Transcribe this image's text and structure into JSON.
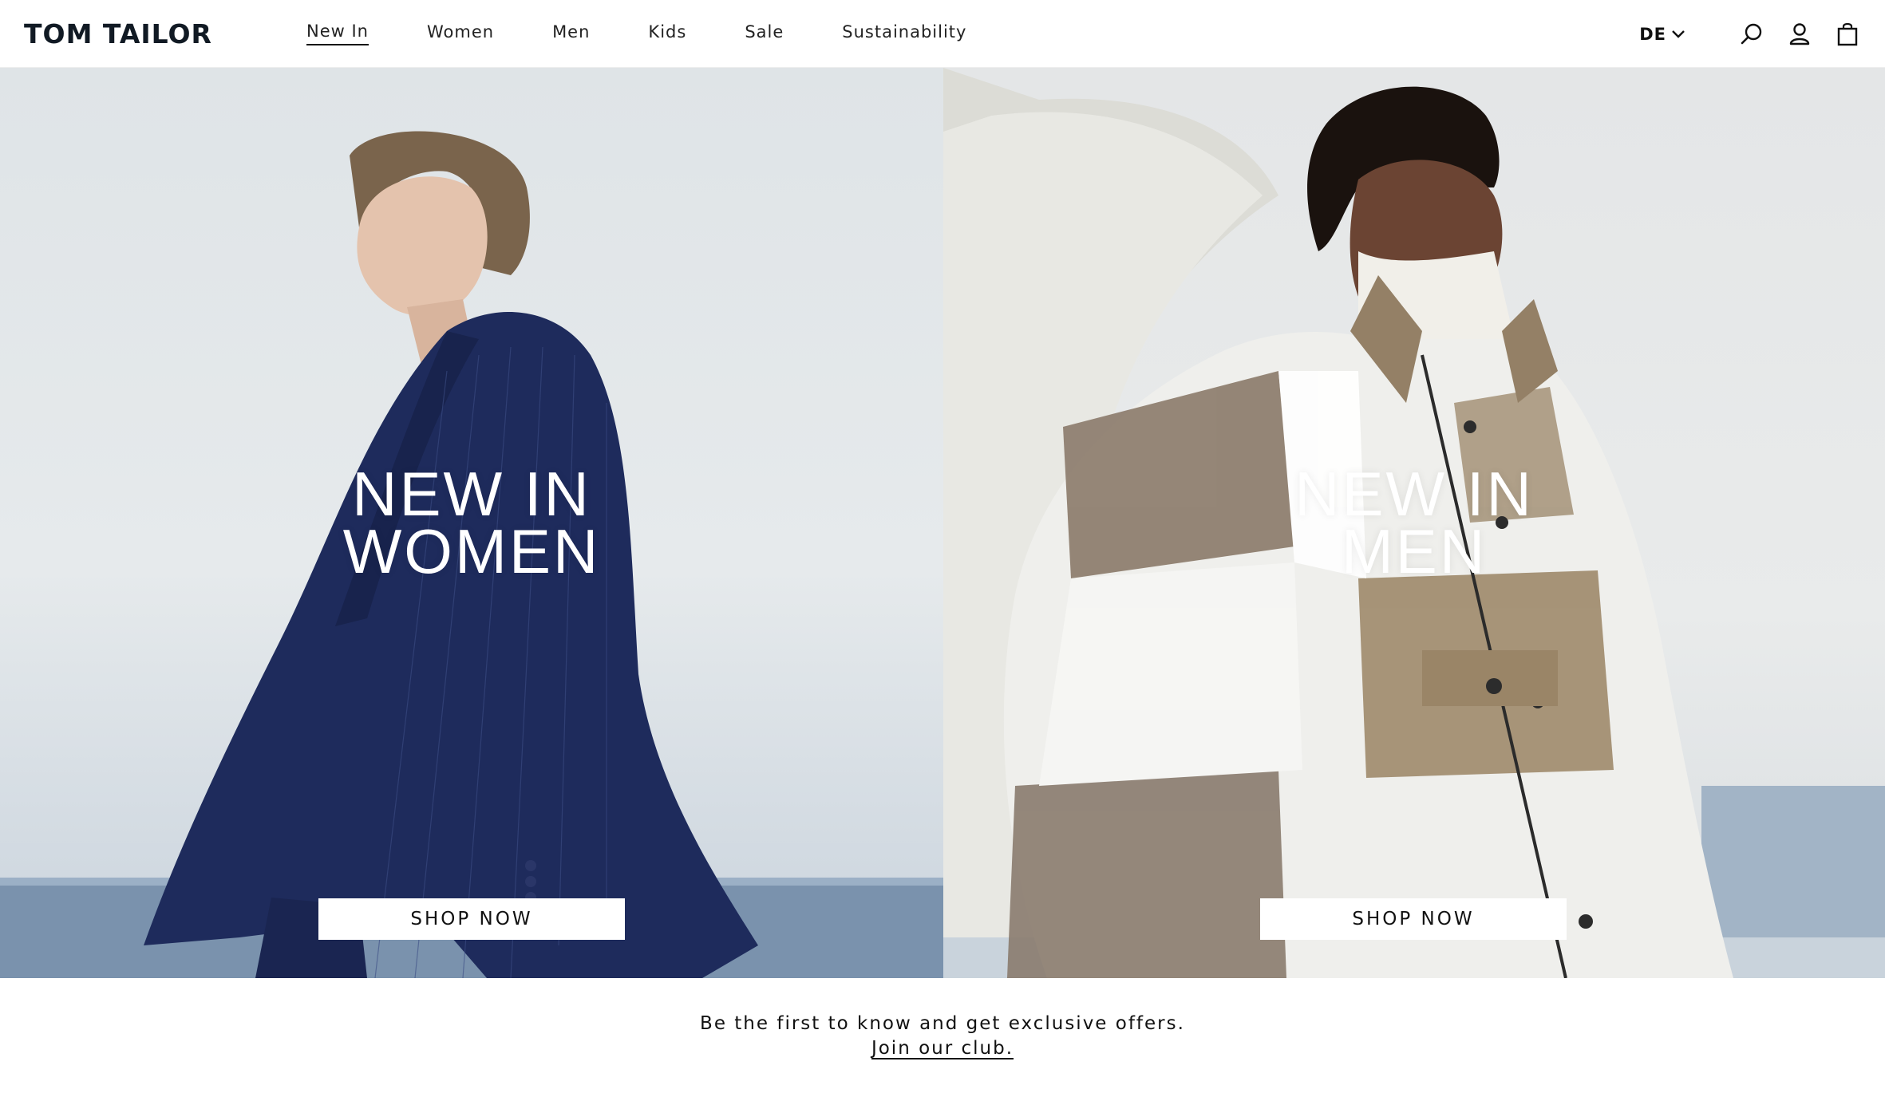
{
  "brand": {
    "name": "TOM TAILOR"
  },
  "nav": {
    "items": [
      {
        "label": "New In",
        "active": true
      },
      {
        "label": "Women"
      },
      {
        "label": "Men"
      },
      {
        "label": "Kids"
      },
      {
        "label": "Sale"
      },
      {
        "label": "Sustainability"
      }
    ]
  },
  "utils": {
    "language": "DE",
    "icons": [
      "chevron-down-icon",
      "search-icon",
      "account-icon",
      "bag-icon"
    ]
  },
  "hero": {
    "women": {
      "line1": "NEW IN",
      "line2": "WOMEN",
      "button": "SHOP NOW"
    },
    "men": {
      "line1": "NEW IN",
      "line2": "MEN",
      "button": "SHOP NOW"
    }
  },
  "club": {
    "text": "Be the first to know and get exclusive offers.",
    "link": "Join our club."
  },
  "colors": {
    "text": "#111111",
    "background": "#ffffff",
    "women_jacket": "#1c2a5a",
    "sea": "#7890ac"
  }
}
